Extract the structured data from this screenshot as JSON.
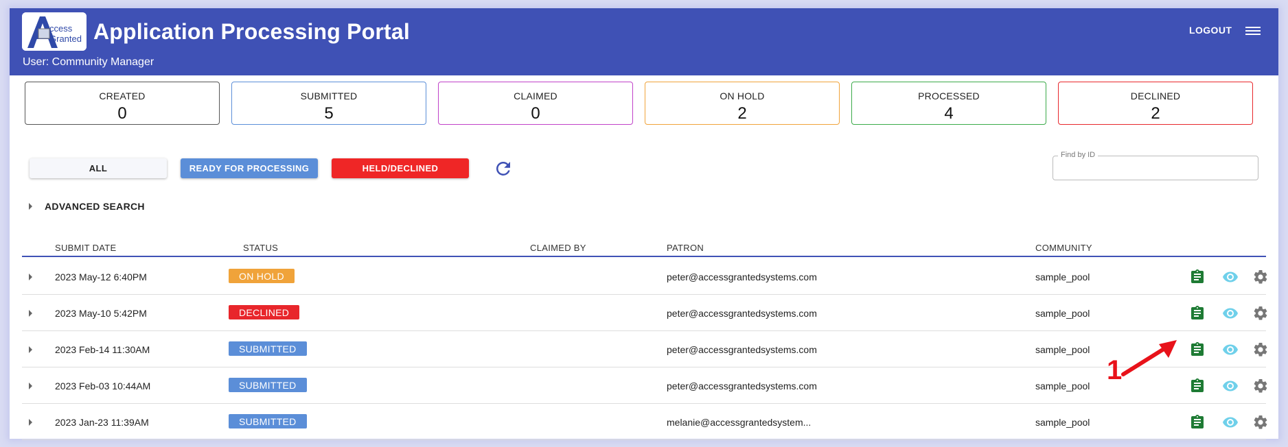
{
  "header": {
    "logo_text_top": "ccess",
    "logo_text_bottom": "Granted",
    "title": "Application Processing Portal",
    "user": "User: Community Manager",
    "logout": "LOGOUT"
  },
  "cards": [
    {
      "label": "CREATED",
      "value": "0",
      "color": "#555555"
    },
    {
      "label": "SUBMITTED",
      "value": "5",
      "color": "#5b8ed8"
    },
    {
      "label": "CLAIMED",
      "value": "0",
      "color": "#c041c8"
    },
    {
      "label": "ON HOLD",
      "value": "2",
      "color": "#f0a33a"
    },
    {
      "label": "PROCESSED",
      "value": "4",
      "color": "#3aaa48"
    },
    {
      "label": "DECLINED",
      "value": "2",
      "color": "#e8262b"
    }
  ],
  "filters": {
    "all": "ALL",
    "ready": "READY FOR PROCESSING",
    "held": "HELD/DECLINED"
  },
  "find": {
    "label": "Find by ID",
    "value": ""
  },
  "advanced_search": "ADVANCED SEARCH",
  "table": {
    "columns": {
      "submit_date": "SUBMIT DATE",
      "status": "STATUS",
      "claimed_by": "CLAIMED BY",
      "patron": "PATRON",
      "community": "COMMUNITY"
    },
    "rows": [
      {
        "date": "2023 May-12 6:40PM",
        "status": "ON HOLD",
        "status_color": "#f0a33a",
        "claimed_by": "",
        "patron": "peter@accessgrantedsystems.com",
        "community": "sample_pool"
      },
      {
        "date": "2023 May-10 5:42PM",
        "status": "DECLINED",
        "status_color": "#e8262b",
        "claimed_by": "",
        "patron": "peter@accessgrantedsystems.com",
        "community": "sample_pool"
      },
      {
        "date": "2023 Feb-14 11:30AM",
        "status": "SUBMITTED",
        "status_color": "#5b8ed8",
        "claimed_by": "",
        "patron": "peter@accessgrantedsystems.com",
        "community": "sample_pool"
      },
      {
        "date": "2023 Feb-03 10:44AM",
        "status": "SUBMITTED",
        "status_color": "#5b8ed8",
        "claimed_by": "",
        "patron": "peter@accessgrantedsystems.com",
        "community": "sample_pool"
      },
      {
        "date": "2023 Jan-23 11:39AM",
        "status": "SUBMITTED",
        "status_color": "#5b8ed8",
        "claimed_by": "",
        "patron": "melanie@accessgrantedsystem...",
        "community": "sample_pool"
      }
    ],
    "action_icons": [
      "clipboard-icon",
      "eye-icon",
      "gear-icon"
    ]
  },
  "annotation": {
    "number": "1",
    "color": "#e8121a"
  },
  "colors": {
    "primary": "#3f51b5",
    "clipboard": "#1e7b34",
    "eye": "#6fd0ea",
    "gear": "#777777"
  }
}
